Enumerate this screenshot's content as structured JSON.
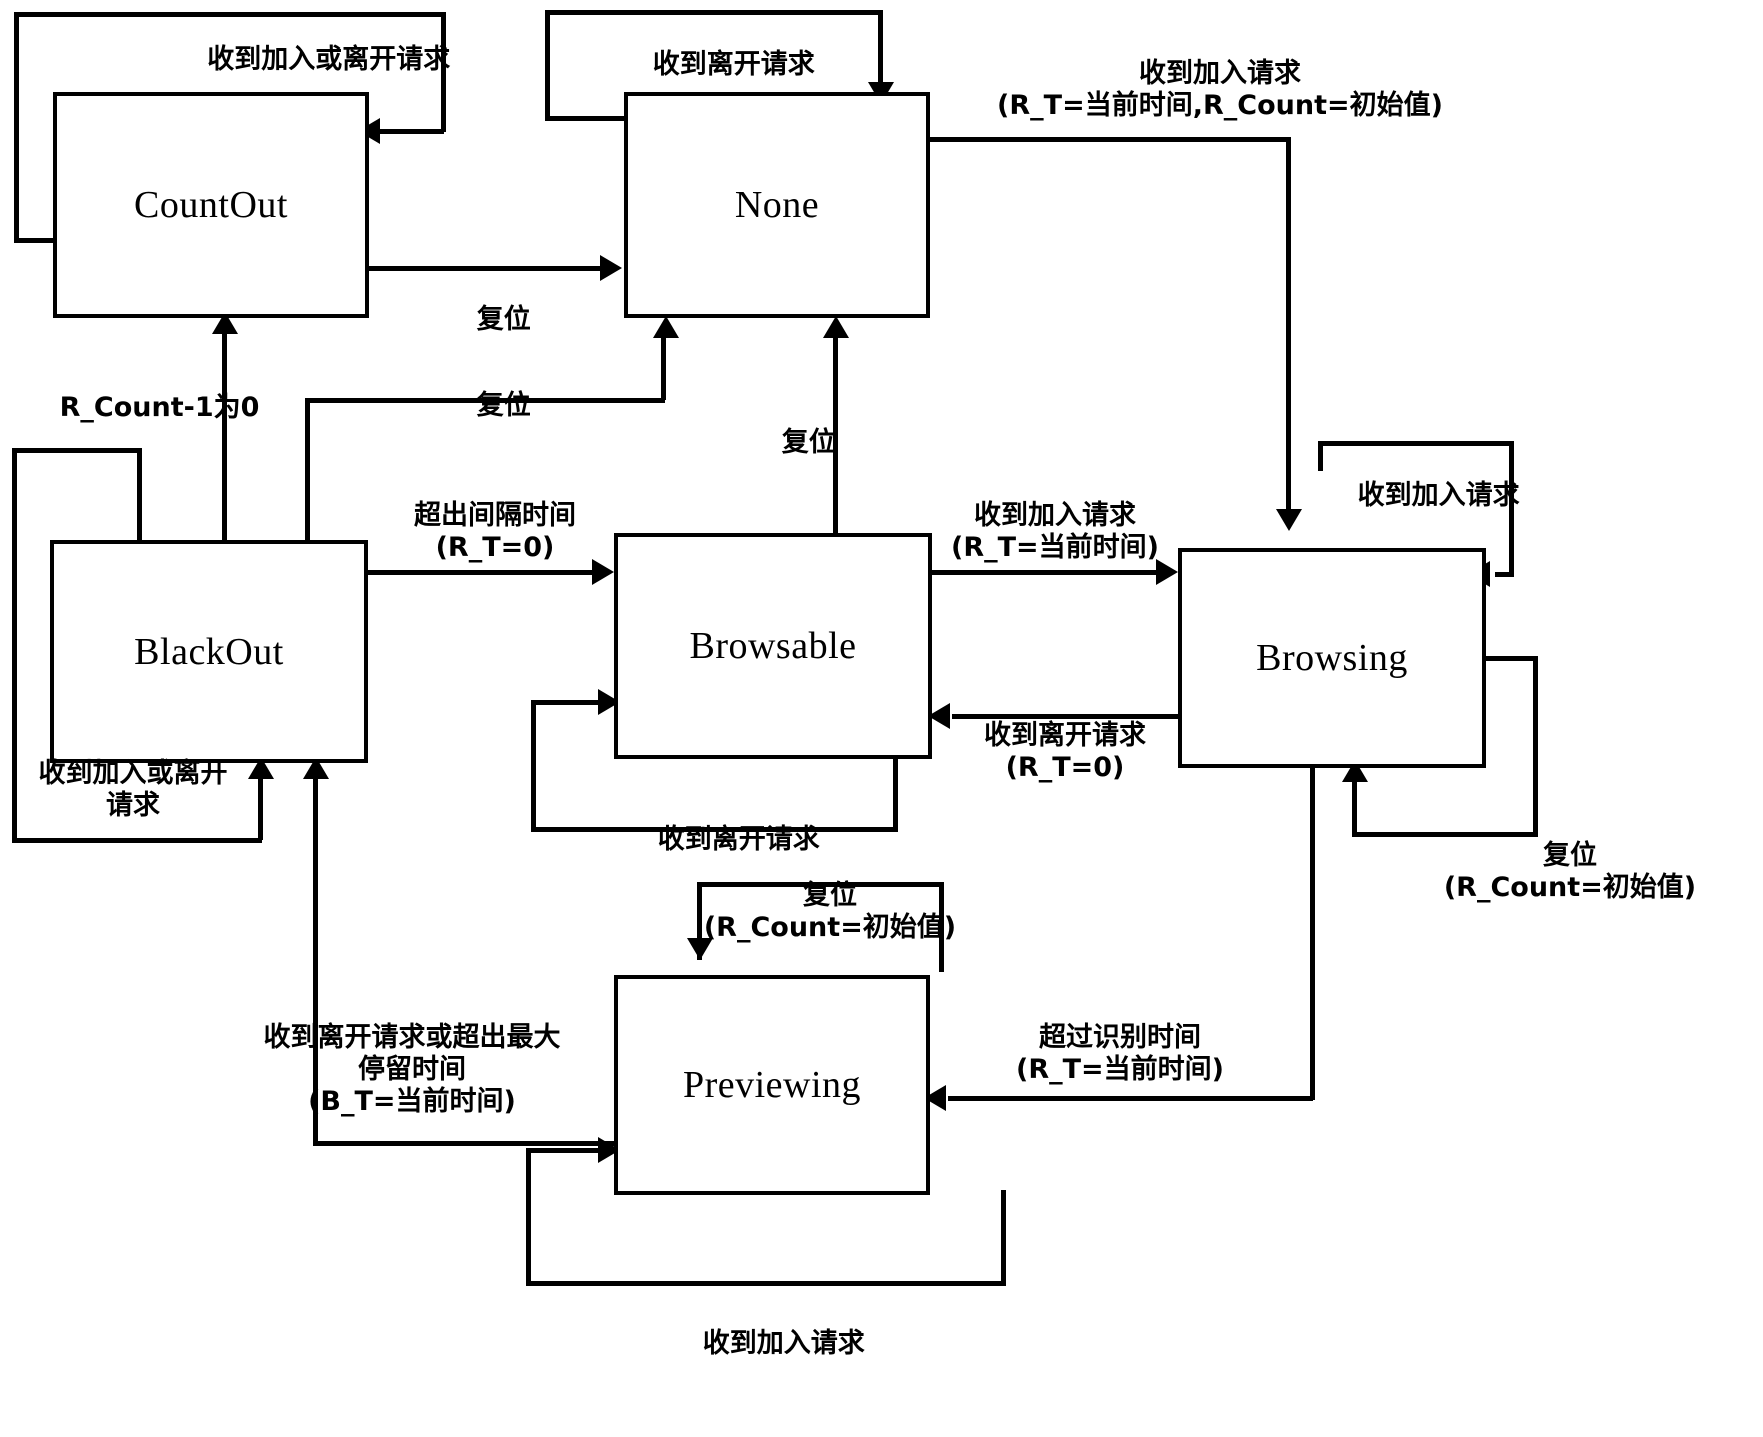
{
  "diagram": {
    "title": "",
    "type": "state-machine",
    "states": [
      {
        "id": "countout",
        "label": "CountOut"
      },
      {
        "id": "none",
        "label": "None"
      },
      {
        "id": "blackout",
        "label": "BlackOut"
      },
      {
        "id": "browsable",
        "label": "Browsable"
      },
      {
        "id": "browsing",
        "label": "Browsing"
      },
      {
        "id": "previewing",
        "label": "Previewing"
      }
    ],
    "transitions": [
      {
        "id": "t1",
        "from": "countout",
        "to": "countout",
        "label": "收到加入或离开请求"
      },
      {
        "id": "t2",
        "from": "none",
        "to": "none",
        "label": "收到离开请求"
      },
      {
        "id": "t3",
        "from": "none",
        "to": "browsing",
        "label_line1": "收到加入请求",
        "label_line2": "(R_T=当前时间,R_Count=初始值)"
      },
      {
        "id": "t4",
        "from": "countout",
        "to": "none",
        "label": "复位"
      },
      {
        "id": "t5",
        "from": "blackout",
        "to": "countout",
        "label": "R_Count-1为0"
      },
      {
        "id": "t6",
        "from": "blackout",
        "to": "none",
        "label": "复位"
      },
      {
        "id": "t7",
        "from": "browsable",
        "to": "none",
        "label": "复位"
      },
      {
        "id": "t8",
        "from": "blackout",
        "to": "blackout",
        "label_line1": "收到加入或离开",
        "label_line2": "请求"
      },
      {
        "id": "t9",
        "from": "blackout",
        "to": "browsable",
        "label_line1": "超出间隔时间",
        "label_line2": "(R_T=0)"
      },
      {
        "id": "t10",
        "from": "browsable",
        "to": "browsing",
        "label_line1": "收到加入请求",
        "label_line2": "(R_T=当前时间)"
      },
      {
        "id": "t11",
        "from": "browsable",
        "to": "browsable",
        "label": "收到离开请求"
      },
      {
        "id": "t12",
        "from": "browsing",
        "to": "browsing",
        "label": "收到加入请求"
      },
      {
        "id": "t13",
        "from": "browsing",
        "to": "browsable",
        "label_line1": "收到离开请求",
        "label_line2": "(R_T=0)"
      },
      {
        "id": "t14",
        "from": "browsing",
        "to": "browsing",
        "label_line1": "复位",
        "label_line2": "(R_Count=初始值)"
      },
      {
        "id": "t15",
        "from": "browsing",
        "to": "previewing",
        "label_line1": "超过识别时间",
        "label_line2": "(R_T=当前时间)"
      },
      {
        "id": "t16",
        "from": "previewing",
        "to": "previewing",
        "label_line1": "复位",
        "label_line2": "(R_Count=初始值)"
      },
      {
        "id": "t17",
        "from": "previewing",
        "to": "blackout",
        "label_line1": "收到离开请求或超出最大",
        "label_line2": "停留时间",
        "label_line3": "(B_T=当前时间)"
      },
      {
        "id": "t18",
        "from": "previewing",
        "to": "previewing",
        "label": "收到加入请求"
      }
    ]
  }
}
